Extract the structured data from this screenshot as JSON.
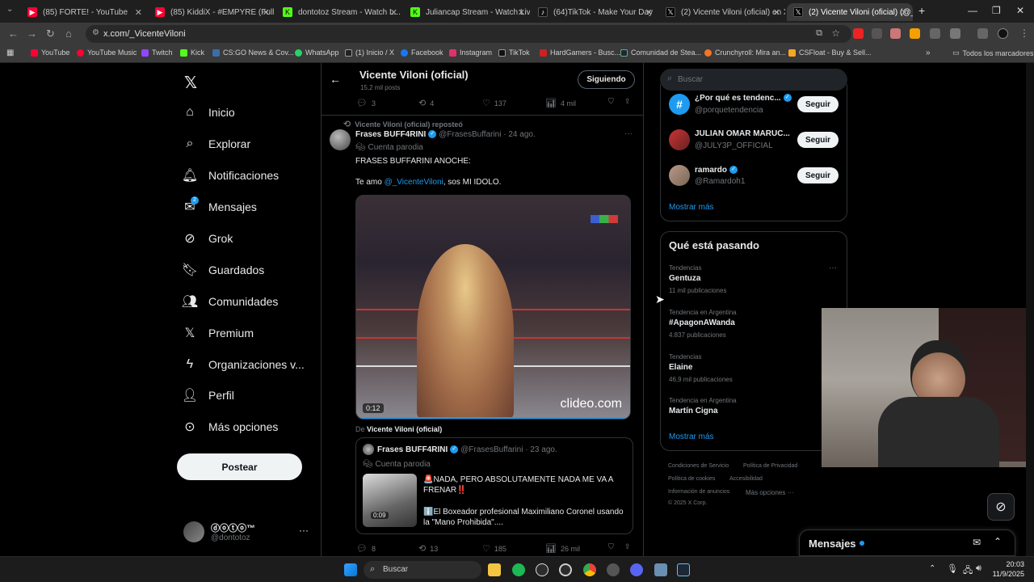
{
  "browser": {
    "tabs": [
      {
        "label": "(85) FORTE! - YouTube",
        "color": "#ff0033"
      },
      {
        "label": "(85) KiddiX - #EMPYRE (Full Mu...",
        "color": "#ff0033"
      },
      {
        "label": "dontotoz Stream - Watch L...",
        "color": "#53fc18"
      },
      {
        "label": "Juliancap Stream - Watch Live ...",
        "color": "#53fc18"
      },
      {
        "label": "(64)TikTok - Make Your Day",
        "color": "#111111"
      },
      {
        "label": "(2) Vicente Viloni (oficial) en X",
        "color": "#000000"
      },
      {
        "label": "(2) Vicente Viloni (oficial) (@_V",
        "color": "#000000"
      }
    ],
    "url": "x.com/_VicenteViloni",
    "bookmarks": [
      {
        "label": "YouTube",
        "color": "#ff0033"
      },
      {
        "label": "YouTube Music",
        "color": "#ff0033"
      },
      {
        "label": "Twitch",
        "color": "#9146ff"
      },
      {
        "label": "Kick",
        "color": "#53fc18"
      },
      {
        "label": "CS:GO News & Cov...",
        "color": "#3b6ea8"
      },
      {
        "label": "WhatsApp",
        "color": "#25d366"
      },
      {
        "label": "(1) Inicio / X",
        "color": "#222222"
      },
      {
        "label": "Facebook",
        "color": "#1877f2"
      },
      {
        "label": "Instagram",
        "color": "#e1306c"
      },
      {
        "label": "TikTok",
        "color": "#111111"
      },
      {
        "label": "HardGamers - Busc...",
        "color": "#cc2222"
      },
      {
        "label": "Comunidad de Stea...",
        "color": "#1b2838"
      },
      {
        "label": "Crunchyroll: Mira an...",
        "color": "#f47521"
      },
      {
        "label": "CSFloat - Buy & Sell...",
        "color": "#f5a623"
      }
    ],
    "bookmarks_folder": "Todos los marcadores"
  },
  "nav": {
    "items": [
      "Inicio",
      "Explorar",
      "Notificaciones",
      "Mensajes",
      "Grok",
      "Guardados",
      "Comunidades",
      "Premium",
      "Organizaciones v...",
      "Perfil",
      "Más opciones"
    ],
    "messages_badge": "2",
    "post_button": "Postear",
    "account_name": "ⓓⓞⓣⓞ™",
    "account_handle": "@dontotoz"
  },
  "header": {
    "title": "Vicente Viloni (oficial)",
    "posts_count": "15,2 mil posts",
    "following_button": "Siguiendo"
  },
  "top_actions": {
    "replies": "3",
    "reposts": "4",
    "likes": "137",
    "views": "4 mil"
  },
  "post": {
    "repost_label": "Vicente Viloni (oficial) reposteó",
    "author": "Frases BUFF4RINI",
    "handle": "@FrasesBuffarini",
    "date": "· 24 ago.",
    "parody_label": "Cuenta parodia",
    "text_line1": "FRASES BUFFARINI ANOCHE:",
    "text_prefix": "Te amo ",
    "mention": "@_VicenteViloni",
    "text_suffix": ", sos MI IDOLO.",
    "video_time": "0:12",
    "watermark": "clideo.com",
    "from_prefix": "De ",
    "from_name": "Vicente Viloni (oficial)"
  },
  "quoted": {
    "author": "Frases BUFF4RINI",
    "handle": "@FrasesBuffarini",
    "date": "· 23 ago.",
    "parody_label": "Cuenta parodia",
    "line1": "🚨NADA, PERO ABSOLUTAMENTE NADA ME VA A FRENAR‼️",
    "line2": "ℹ️El Boxeador profesional Maximiliano Coronel usando la \"Mano Prohibida\"....",
    "video_time": "0:09"
  },
  "bottom_actions": {
    "replies": "8",
    "reposts": "13",
    "likes": "185",
    "views": "26 mil"
  },
  "right": {
    "search_placeholder": "Buscar",
    "who_to_follow": [
      {
        "name": "¿Por qué es tendenc...",
        "handle": "@porquetendencia",
        "button": "Seguir"
      },
      {
        "name": "JULIAN OMAR MARUC...",
        "handle": "@JULY3P_OFFICIAL",
        "button": "Seguir"
      },
      {
        "name": "ramardo",
        "handle": "@Ramardoh1",
        "button": "Seguir"
      }
    ],
    "show_more_1": "Mostrar más",
    "trends_title": "Qué está pasando",
    "trends": [
      {
        "context": "Tendencias",
        "name": "Gentuza",
        "count": "11 mil publicaciones"
      },
      {
        "context": "Tendencia en Argentina",
        "name": "#ApagonAWanda",
        "count": "4.837 publicaciones"
      },
      {
        "context": "Tendencias",
        "name": "Elaine",
        "count": "46,9 mil publicaciones"
      },
      {
        "context": "Tendencia en Argentina",
        "name": "Martín Cigna",
        "count": ""
      }
    ],
    "show_more_2": "Mostrar más",
    "footer": [
      "Condiciones de Servicio",
      "Política de Privacidad",
      "Política de cookies",
      "Accesibilidad",
      "Información de anuncios",
      "Más opciones ···",
      "© 2025 X Corp."
    ],
    "messages_dock": "Mensajes"
  },
  "taskbar": {
    "search": "Buscar",
    "time": "20:03",
    "date": "11/9/2025"
  }
}
